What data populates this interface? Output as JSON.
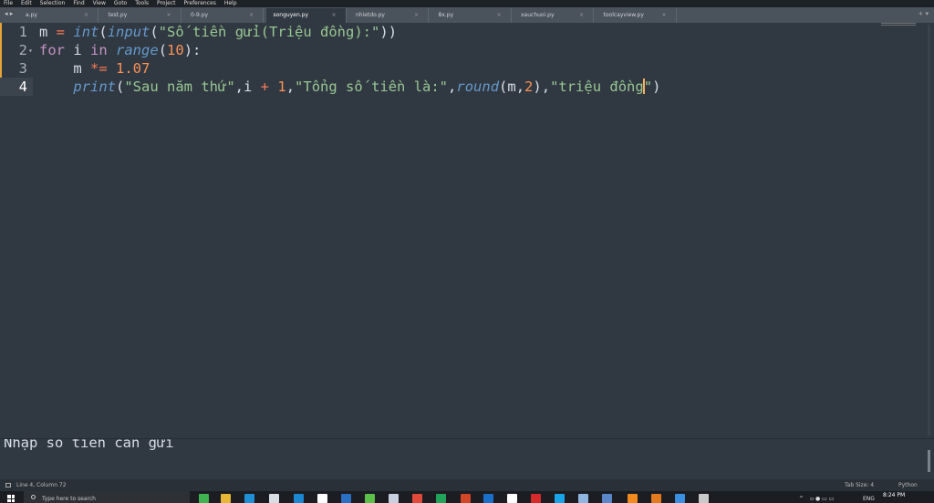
{
  "menu": [
    "File",
    "Edit",
    "Selection",
    "Find",
    "View",
    "Goto",
    "Tools",
    "Project",
    "Preferences",
    "Help"
  ],
  "tabs": [
    {
      "label": "a.py"
    },
    {
      "label": "test.py"
    },
    {
      "label": "0-9.py"
    },
    {
      "label": "songuyen.py",
      "active": true
    },
    {
      "label": "nhietdo.py"
    },
    {
      "label": "8x.py"
    },
    {
      "label": "xauchuoi.py"
    },
    {
      "label": "toolcayview.py"
    }
  ],
  "tab_close": "×",
  "editor": {
    "line_numbers": [
      "1",
      "2",
      "3",
      "4"
    ],
    "lines": [
      [
        {
          "t": "m ",
          "c": "pn"
        },
        {
          "t": "=",
          "c": "op"
        },
        {
          "t": " ",
          "c": "pn"
        },
        {
          "t": "int",
          "c": "fn"
        },
        {
          "t": "(",
          "c": "pn"
        },
        {
          "t": "input",
          "c": "fn"
        },
        {
          "t": "(",
          "c": "pn"
        },
        {
          "t": "\"Số tiền gửi(Triệu đồng):\"",
          "c": "str"
        },
        {
          "t": "))",
          "c": "pn"
        }
      ],
      [
        {
          "t": "for",
          "c": "kw"
        },
        {
          "t": " i ",
          "c": "pn"
        },
        {
          "t": "in",
          "c": "kw"
        },
        {
          "t": " ",
          "c": "pn"
        },
        {
          "t": "range",
          "c": "fn"
        },
        {
          "t": "(",
          "c": "pn"
        },
        {
          "t": "10",
          "c": "num"
        },
        {
          "t": "):",
          "c": "pn"
        }
      ],
      [
        {
          "t": "    m ",
          "c": "pn"
        },
        {
          "t": "*=",
          "c": "op"
        },
        {
          "t": " ",
          "c": "pn"
        },
        {
          "t": "1.07",
          "c": "num"
        }
      ],
      [
        {
          "t": "    ",
          "c": "pn"
        },
        {
          "t": "print",
          "c": "fn"
        },
        {
          "t": "(",
          "c": "pn"
        },
        {
          "t": "\"Sau năm thứ\"",
          "c": "str"
        },
        {
          "t": ",i ",
          "c": "pn"
        },
        {
          "t": "+",
          "c": "op"
        },
        {
          "t": " ",
          "c": "pn"
        },
        {
          "t": "1",
          "c": "num"
        },
        {
          "t": ",",
          "c": "pn"
        },
        {
          "t": "\"Tổng số tiền là:\"",
          "c": "str"
        },
        {
          "t": ",",
          "c": "pn"
        },
        {
          "t": "round",
          "c": "fn"
        },
        {
          "t": "(m,",
          "c": "pn"
        },
        {
          "t": "2",
          "c": "num"
        },
        {
          "t": "),",
          "c": "pn"
        },
        {
          "t": "\"triệu đồng",
          "c": "str"
        },
        {
          "t": "CARET",
          "c": "caret"
        },
        {
          "t": "\"",
          "c": "str"
        },
        {
          "t": ")",
          "c": "pn"
        }
      ]
    ],
    "current_line": 4
  },
  "output": {
    "text": "Nhập số tiền cần gửi"
  },
  "status": {
    "position": "Line 4, Column 72",
    "tab_size": "Tab Size: 4",
    "syntax": "Python"
  },
  "taskbar": {
    "search_placeholder": "Type here to search",
    "lang": "ENG",
    "time": "8:24 PM",
    "icons": [
      {
        "name": "green-app",
        "color": "#3fb34f"
      },
      {
        "name": "file-explorer",
        "color": "#e6b836"
      },
      {
        "name": "edge",
        "color": "#1f8fd6"
      },
      {
        "name": "store",
        "color": "#d8dde3"
      },
      {
        "name": "mail",
        "color": "#1b88cf"
      },
      {
        "name": "app",
        "color": "#ffffff"
      },
      {
        "name": "word",
        "color": "#2b6fc2"
      },
      {
        "name": "app2",
        "color": "#5bbf4a"
      },
      {
        "name": "app3",
        "color": "#c9d0e0"
      },
      {
        "name": "chrome",
        "color": "#e04a3a"
      },
      {
        "name": "excel",
        "color": "#21a35a"
      },
      {
        "name": "powerpoint",
        "color": "#d24726"
      },
      {
        "name": "outlook",
        "color": "#1a6fc7"
      },
      {
        "name": "medium",
        "color": "#ffffff"
      },
      {
        "name": "record",
        "color": "#d62b2b"
      },
      {
        "name": "skype",
        "color": "#1aa4e8"
      },
      {
        "name": "photos",
        "color": "#8fb6e0"
      },
      {
        "name": "app4",
        "color": "#5a87c8"
      },
      {
        "name": "sublime",
        "color": "#f28a1e"
      },
      {
        "name": "app5",
        "color": "#e07b1f"
      },
      {
        "name": "app6",
        "color": "#3b8fe0"
      },
      {
        "name": "terminal",
        "color": "#c9c9c9"
      }
    ]
  }
}
